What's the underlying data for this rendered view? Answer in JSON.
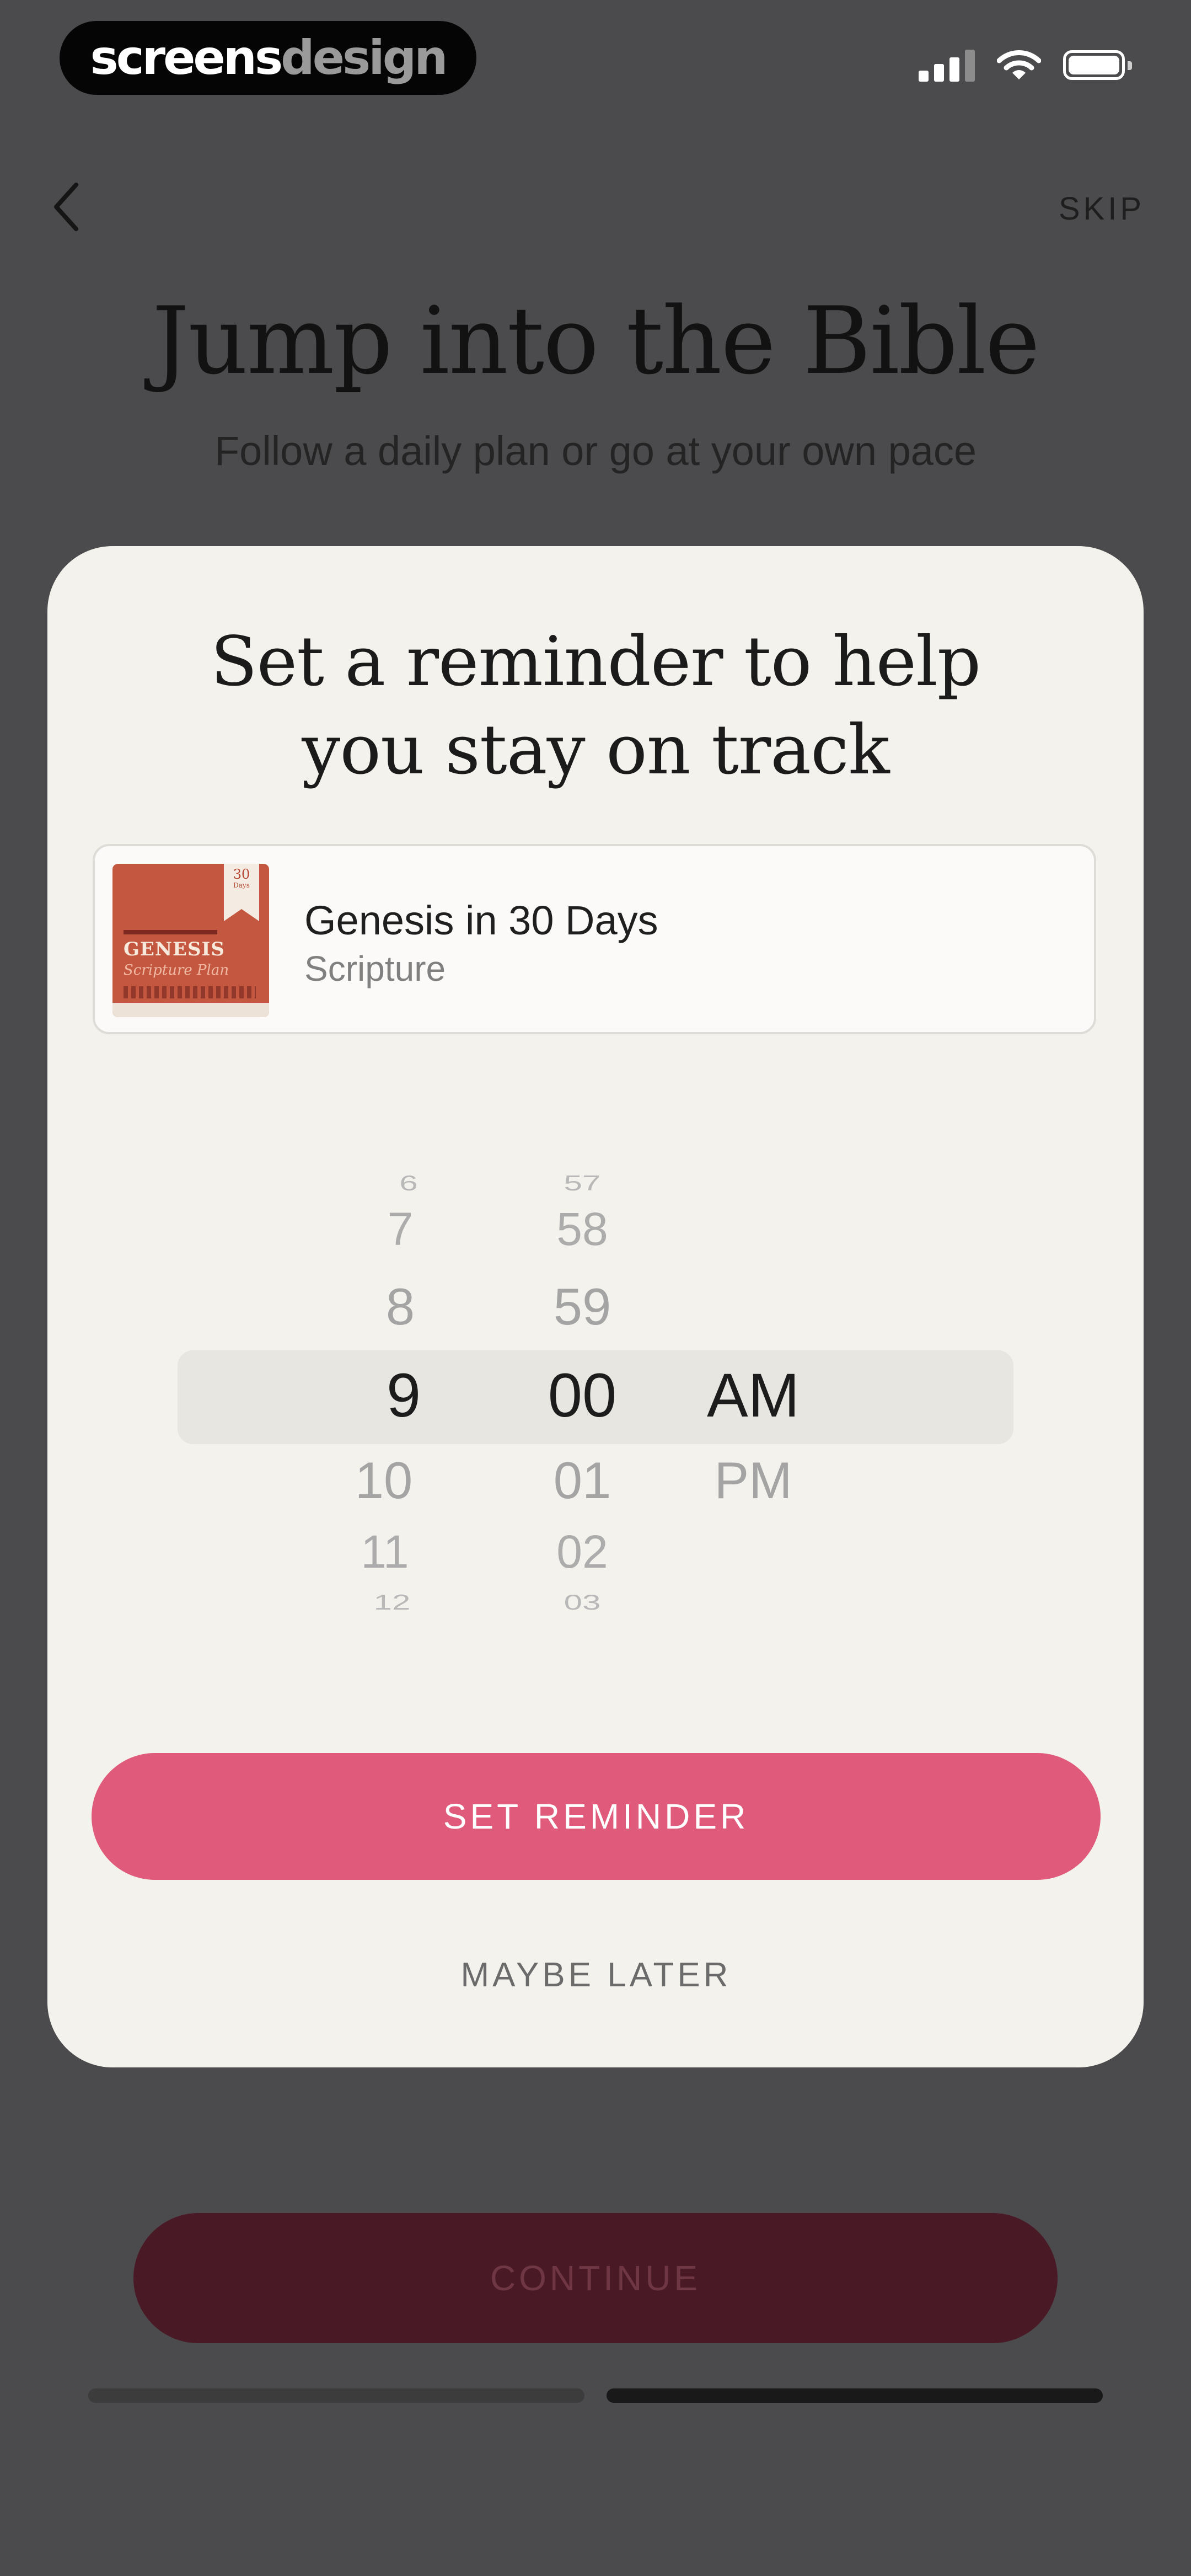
{
  "watermark": {
    "part1": "screens",
    "part2": "design"
  },
  "status_bar": {
    "signal_icon": "cellular-signal-icon",
    "wifi_icon": "wifi-icon",
    "battery_icon": "battery-icon"
  },
  "background_screen": {
    "back_icon": "chevron-left-icon",
    "skip_label": "SKIP",
    "title": "Jump into the Bible",
    "subtitle": "Follow a daily plan or go at your own pace",
    "continue_label": "CONTINUE",
    "progress_steps": 2,
    "progress_current": 2
  },
  "modal": {
    "title_line1": "Set a reminder to help",
    "title_line2": "you stay on track",
    "plan": {
      "cover_badge_number": "30",
      "cover_badge_unit": "Days",
      "cover_title": "GENESIS",
      "cover_subtitle": "Scripture Plan",
      "title": "Genesis in 30 Days",
      "category": "Scripture"
    },
    "time_picker": {
      "hours": [
        "6",
        "7",
        "8",
        "9",
        "10",
        "11",
        "12"
      ],
      "minutes": [
        "57",
        "58",
        "59",
        "00",
        "01",
        "02",
        "03"
      ],
      "periods": [
        "AM",
        "PM"
      ],
      "selected_hour": "9",
      "selected_minute": "00",
      "selected_period": "AM"
    },
    "set_reminder_label": "SET REMINDER",
    "maybe_later_label": "MAYBE LATER"
  },
  "colors": {
    "accent": "#e05b7b",
    "modal_bg": "#f4f2ec",
    "overlay": "#4b4a4c"
  }
}
